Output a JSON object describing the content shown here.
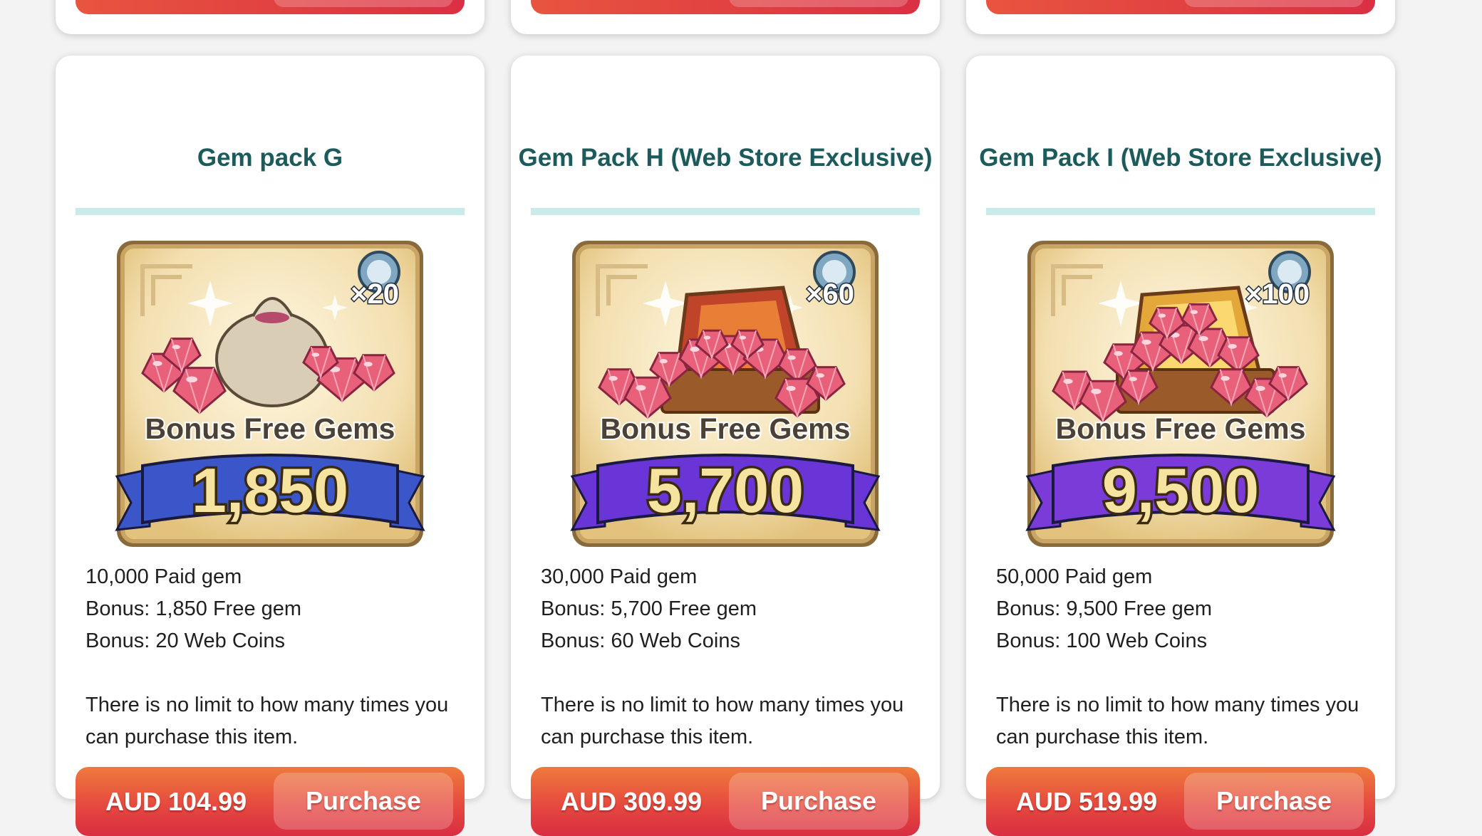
{
  "packs": [
    {
      "title": "Gem pack G",
      "image": {
        "icon": "gem-bag-icon",
        "badge_multiplier": "×20",
        "banner_caption": "Bonus Free Gems",
        "banner_amount": "1,850",
        "ribbon_color": "#3b56c9"
      },
      "details": [
        "10,000 Paid gem",
        "Bonus: 1,850 Free gem",
        "Bonus: 20 Web Coins"
      ],
      "limit_note": [
        "There is no limit to how many times you",
        "can purchase this item."
      ],
      "price": "AUD 104.99",
      "purchase_label": "Purchase"
    },
    {
      "title": "Gem Pack H (Web Store Exclusive)",
      "image": {
        "icon": "gem-chest-icon",
        "badge_multiplier": "×60",
        "banner_caption": "Bonus Free Gems",
        "banner_amount": "5,700",
        "ribbon_color": "#6a35d6"
      },
      "details": [
        "30,000 Paid gem",
        "Bonus: 5,700 Free gem",
        "Bonus: 60 Web Coins"
      ],
      "limit_note": [
        "There is no limit to how many times you",
        "can purchase this item."
      ],
      "price": "AUD 309.99",
      "purchase_label": "Purchase"
    },
    {
      "title": "Gem Pack I (Web Store Exclusive)",
      "image": {
        "icon": "gem-treasure-chest-icon",
        "badge_multiplier": "×100",
        "banner_caption": "Bonus Free Gems",
        "banner_amount": "9,500",
        "ribbon_color": "#7a3bd8"
      },
      "details": [
        "50,000 Paid gem",
        "Bonus: 9,500 Free gem",
        "Bonus: 100 Web Coins"
      ],
      "limit_note": [
        "There is no limit to how many times you",
        "can purchase this item."
      ],
      "price": "AUD 519.99",
      "purchase_label": "Purchase"
    }
  ],
  "colors": {
    "title": "#1c5b5c",
    "divider": "#c9ecea",
    "button_top": "#ee7a3c",
    "button_bottom": "#d92d42"
  }
}
